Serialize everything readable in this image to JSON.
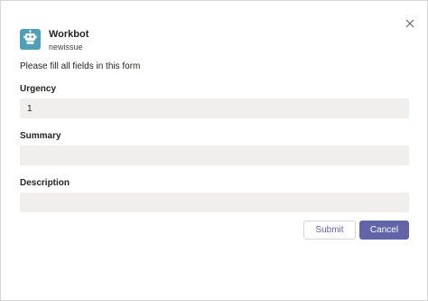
{
  "header": {
    "bot_name": "Workbot",
    "command": "newissue",
    "avatar_icon": "robot-icon",
    "avatar_color": "#4f9fb8"
  },
  "close_icon": "close-icon",
  "form": {
    "instruction": "Please fill all fields in this form",
    "fields": [
      {
        "label": "Urgency",
        "value": "1",
        "placeholder": ""
      },
      {
        "label": "Summary",
        "value": "",
        "placeholder": ""
      },
      {
        "label": "Description",
        "value": "",
        "placeholder": ""
      }
    ]
  },
  "actions": {
    "submit_label": "Submit",
    "cancel_label": "Cancel"
  },
  "colors": {
    "accent": "#6264a7",
    "field_background": "#f0efee"
  }
}
